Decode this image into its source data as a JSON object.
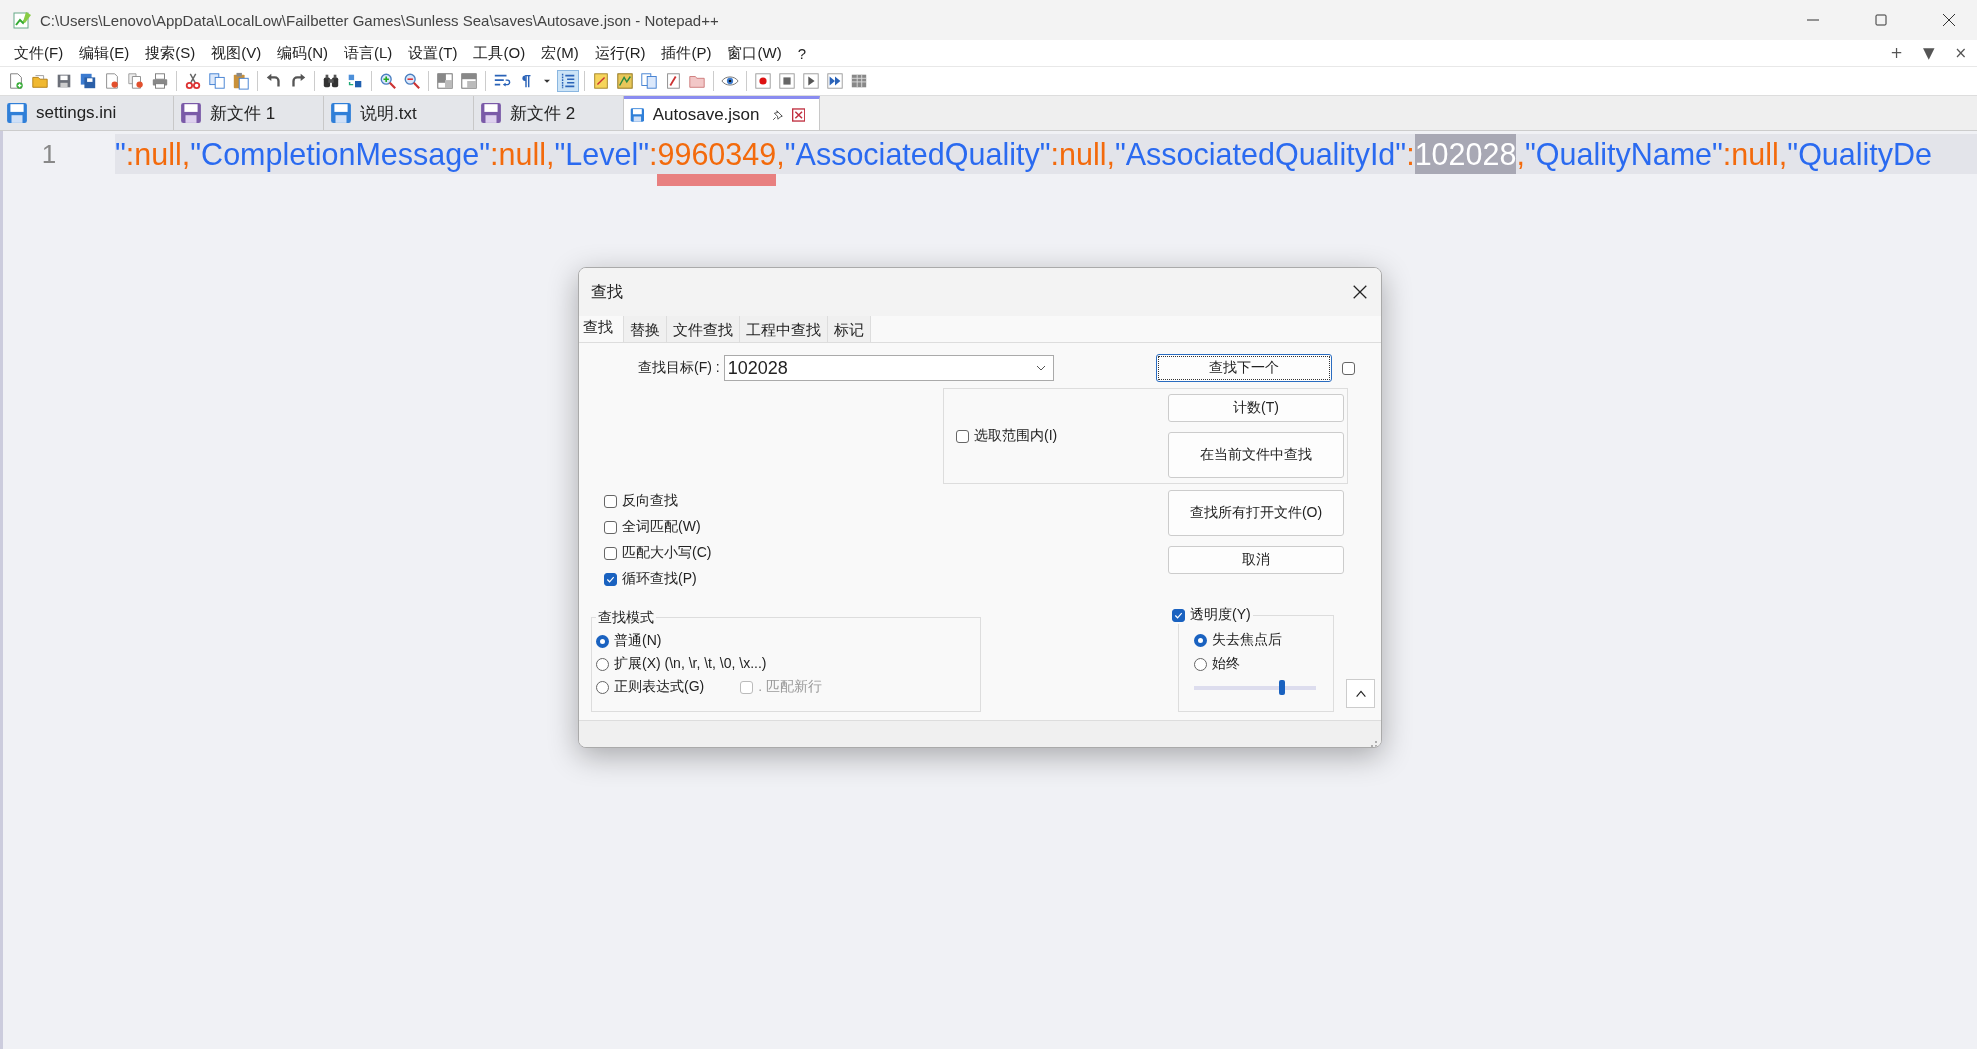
{
  "window": {
    "title": "C:\\Users\\Lenovo\\AppData\\LocalLow\\Failbetter Games\\Sunless Sea\\saves\\Autosave.json - Notepad++"
  },
  "menu": [
    "文件(F)",
    "编辑(E)",
    "搜索(S)",
    "视图(V)",
    "编码(N)",
    "语言(L)",
    "设置(T)",
    "工具(O)",
    "宏(M)",
    "运行(R)",
    "插件(P)",
    "窗口(W)",
    "?"
  ],
  "menu_right": [
    "+",
    "▼",
    "×"
  ],
  "toolbar": [
    [
      {
        "kind": "new",
        "pressed": false
      },
      {
        "kind": "open",
        "pressed": false
      },
      {
        "kind": "save",
        "pressed": false
      },
      {
        "kind": "saveall",
        "pressed": false
      },
      {
        "kind": "close",
        "pressed": false
      },
      {
        "kind": "closeall",
        "pressed": false
      },
      {
        "kind": "print",
        "pressed": false
      }
    ],
    [
      {
        "kind": "cut",
        "pressed": false
      },
      {
        "kind": "copy",
        "pressed": false
      },
      {
        "kind": "paste",
        "pressed": false
      }
    ],
    [
      {
        "kind": "undo",
        "pressed": false
      },
      {
        "kind": "redo",
        "pressed": false
      }
    ],
    [
      {
        "kind": "find",
        "pressed": false
      },
      {
        "kind": "replace",
        "pressed": false
      }
    ],
    [
      {
        "kind": "zoomin",
        "pressed": false
      },
      {
        "kind": "zoomout",
        "pressed": false
      }
    ],
    [
      {
        "kind": "syncv",
        "pressed": false
      },
      {
        "kind": "synch",
        "pressed": false
      }
    ],
    [
      {
        "kind": "wrap",
        "pressed": false
      },
      {
        "kind": "pilcrow",
        "pressed": false
      },
      {
        "kind": "dropdown",
        "pressed": false
      },
      {
        "kind": "indent",
        "pressed": true
      }
    ],
    [
      {
        "kind": "udl",
        "pressed": false
      },
      {
        "kind": "docmap",
        "pressed": false
      },
      {
        "kind": "doclist",
        "pressed": false
      },
      {
        "kind": "funclist",
        "pressed": false
      },
      {
        "kind": "folder",
        "pressed": false
      }
    ],
    [
      {
        "kind": "monitor",
        "pressed": false
      }
    ],
    [
      {
        "kind": "record",
        "pressed": false
      },
      {
        "kind": "stop",
        "pressed": false
      },
      {
        "kind": "play",
        "pressed": false
      },
      {
        "kind": "playmulti",
        "pressed": false
      },
      {
        "kind": "savemacro",
        "pressed": false
      }
    ]
  ],
  "tabs": [
    {
      "label": "settings.ini",
      "saved": true,
      "selected": false
    },
    {
      "label": "新文件 1",
      "saved": false,
      "selected": false
    },
    {
      "label": "说明.txt",
      "saved": true,
      "selected": false
    },
    {
      "label": "新文件 2",
      "saved": false,
      "selected": false
    },
    {
      "label": "Autosave.json",
      "saved": true,
      "selected": true
    }
  ],
  "editor": {
    "line_number": "1",
    "tokens": [
      {
        "text": "\"",
        "kind": "string",
        "highlighted": false,
        "marked": false
      },
      {
        "text": ":",
        "kind": "operator",
        "highlighted": false,
        "marked": false
      },
      {
        "text": "null",
        "kind": "keyword",
        "highlighted": false,
        "marked": false
      },
      {
        "text": ",",
        "kind": "operator",
        "highlighted": false,
        "marked": false
      },
      {
        "text": "\"CompletionMessage\"",
        "kind": "string",
        "highlighted": false,
        "marked": false
      },
      {
        "text": ":",
        "kind": "operator",
        "highlighted": false,
        "marked": false
      },
      {
        "text": "null",
        "kind": "keyword",
        "highlighted": false,
        "marked": false
      },
      {
        "text": ",",
        "kind": "operator",
        "highlighted": false,
        "marked": false
      },
      {
        "text": "\"Level\"",
        "kind": "string",
        "highlighted": false,
        "marked": false
      },
      {
        "text": ":",
        "kind": "operator",
        "highlighted": false,
        "marked": false
      },
      {
        "text": "9960349",
        "kind": "number",
        "highlighted": false,
        "marked": true
      },
      {
        "text": ",",
        "kind": "operator",
        "highlighted": false,
        "marked": false
      },
      {
        "text": "\"AssociatedQuality\"",
        "kind": "string",
        "highlighted": false,
        "marked": false
      },
      {
        "text": ":",
        "kind": "operator",
        "highlighted": false,
        "marked": false
      },
      {
        "text": "null",
        "kind": "keyword",
        "highlighted": false,
        "marked": false
      },
      {
        "text": ",",
        "kind": "operator",
        "highlighted": false,
        "marked": false
      },
      {
        "text": "\"AssociatedQualityId\"",
        "kind": "string",
        "highlighted": false,
        "marked": false
      },
      {
        "text": ":",
        "kind": "operator",
        "highlighted": false,
        "marked": false
      },
      {
        "text": "102028",
        "kind": "number",
        "highlighted": true,
        "marked": false
      },
      {
        "text": ",",
        "kind": "operator",
        "highlighted": false,
        "marked": false
      },
      {
        "text": "\"QualityName\"",
        "kind": "string",
        "highlighted": false,
        "marked": false
      },
      {
        "text": ":",
        "kind": "operator",
        "highlighted": false,
        "marked": false
      },
      {
        "text": "null",
        "kind": "keyword",
        "highlighted": false,
        "marked": false
      },
      {
        "text": ",",
        "kind": "operator",
        "highlighted": false,
        "marked": false
      },
      {
        "text": "\"QualityDe",
        "kind": "string",
        "highlighted": false,
        "marked": false
      }
    ]
  },
  "find_dialog": {
    "title": "查找",
    "tabs": [
      {
        "label": "查找",
        "selected": true
      },
      {
        "label": "替换",
        "selected": false
      },
      {
        "label": "文件查找",
        "selected": false
      },
      {
        "label": "工程中查找",
        "selected": false
      },
      {
        "label": "标记",
        "selected": false
      }
    ],
    "search": {
      "label": "查找目标(F) :",
      "value": "102028"
    },
    "find_next": {
      "label": "查找下一个",
      "focused": true
    },
    "side_checkbox": {
      "checked": false
    },
    "scope": {
      "label": "选取范围内(I)",
      "checked": false
    },
    "scope_buttons": [
      {
        "label": "计数(T)",
        "kind": "short"
      },
      {
        "label": "在当前文件中查找",
        "kind": "tall"
      }
    ],
    "buttons": [
      {
        "label": "查找所有打开文件(O)",
        "kind": "tall"
      },
      {
        "label": "取消",
        "kind": "short"
      }
    ],
    "options": [
      {
        "label": "反向查找",
        "checked": false
      },
      {
        "label": "全词匹配(W)",
        "checked": false
      },
      {
        "label": "匹配大小写(C)",
        "checked": false
      },
      {
        "label": "循环查找(P)",
        "checked": true
      }
    ],
    "mode": {
      "title": "查找模式",
      "options": [
        {
          "label": "普通(N)",
          "selected": true
        },
        {
          "label": "扩展(X) (\\n, \\r, \\t, \\0, \\x...)",
          "selected": false
        },
        {
          "label": "正则表达式(G)",
          "selected": false
        }
      ],
      "dot_newline": {
        "label": ". 匹配新行",
        "checked": false,
        "disabled": true
      }
    },
    "transparency": {
      "label": "透明度(Y)",
      "checked": true,
      "options": [
        {
          "label": "失去焦点后",
          "selected": true
        },
        {
          "label": "始终",
          "selected": false
        }
      ],
      "level": 0.72
    }
  }
}
